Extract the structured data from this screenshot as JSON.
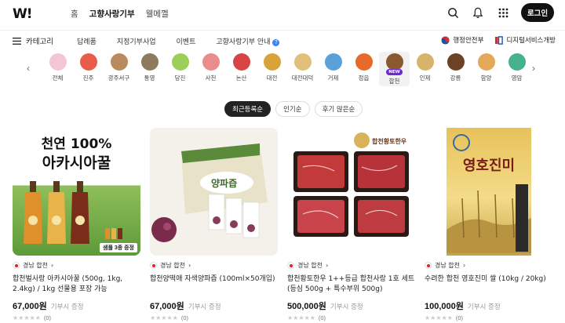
{
  "header": {
    "logo": "W!",
    "nav": [
      "홈",
      "고향사랑기부",
      "웰메껠"
    ],
    "active_nav": 1,
    "login_label": "로그인"
  },
  "subnav": {
    "category_label": "카테고리",
    "items": [
      "답례품",
      "지정기부사업",
      "이벤트",
      "고향사랑기부 안내"
    ],
    "partners": [
      "행정안전부",
      "디지털서비스개방"
    ]
  },
  "regions": [
    {
      "label": "전체",
      "color": "#f3c6d4"
    },
    {
      "label": "진주",
      "color": "#e85c4a"
    },
    {
      "label": "광주서구",
      "color": "#b98a5c"
    },
    {
      "label": "통영",
      "color": "#8c7b5e"
    },
    {
      "label": "당진",
      "color": "#9ccf5a"
    },
    {
      "label": "사천",
      "color": "#e98c8c"
    },
    {
      "label": "논산",
      "color": "#d94545"
    },
    {
      "label": "대전",
      "color": "#d9a33a"
    },
    {
      "label": "대전대덕",
      "color": "#e0c07a"
    },
    {
      "label": "거제",
      "color": "#5aa0d9"
    },
    {
      "label": "정읍",
      "color": "#e86a2a"
    },
    {
      "label": "합천",
      "color": "#8a5a2e",
      "badge": "NEW"
    },
    {
      "label": "인제",
      "color": "#d8b36a"
    },
    {
      "label": "강릉",
      "color": "#6b4226"
    },
    {
      "label": "함양",
      "color": "#e4a85a"
    },
    {
      "label": "영암",
      "color": "#46b28c"
    }
  ],
  "selected_region": 11,
  "sort": {
    "options": [
      "최근등록순",
      "인기순",
      "후기 많은순"
    ],
    "active": 0
  },
  "products": [
    {
      "region": "경남 합천",
      "name": "합천벌사랑 아카시아꿀 (500g, 1kg, 2.4kg) / 1kg 선물용 포장 가능",
      "price": "67,000원",
      "donate": "기부시 증정",
      "reviews": "(0)",
      "image_text": [
        "천연 100%",
        "아카시아꿀",
        "샘플 3종 증정"
      ]
    },
    {
      "region": "경남 합천",
      "name": "합천양떡애 자색양파즙 (100ml×50개입)",
      "price": "67,000원",
      "donate": "기부시 증정",
      "reviews": "(0)",
      "image_text": [
        "양파즙"
      ]
    },
    {
      "region": "경남 합천",
      "name": "합천황토한우 1++등급 합천사랑 1호 세트 (등심 500g + 특수부위 500g)",
      "price": "500,000원",
      "donate": "기부시 증정",
      "reviews": "(0)",
      "image_text": [
        "합천황토한우"
      ]
    },
    {
      "region": "경남 합천",
      "name": "수려한 합천 영호진미 쌀 (10kg / 20kg)",
      "price": "100,000원",
      "donate": "기부시 증정",
      "reviews": "(0)",
      "image_text": [
        "영호진미"
      ]
    }
  ]
}
